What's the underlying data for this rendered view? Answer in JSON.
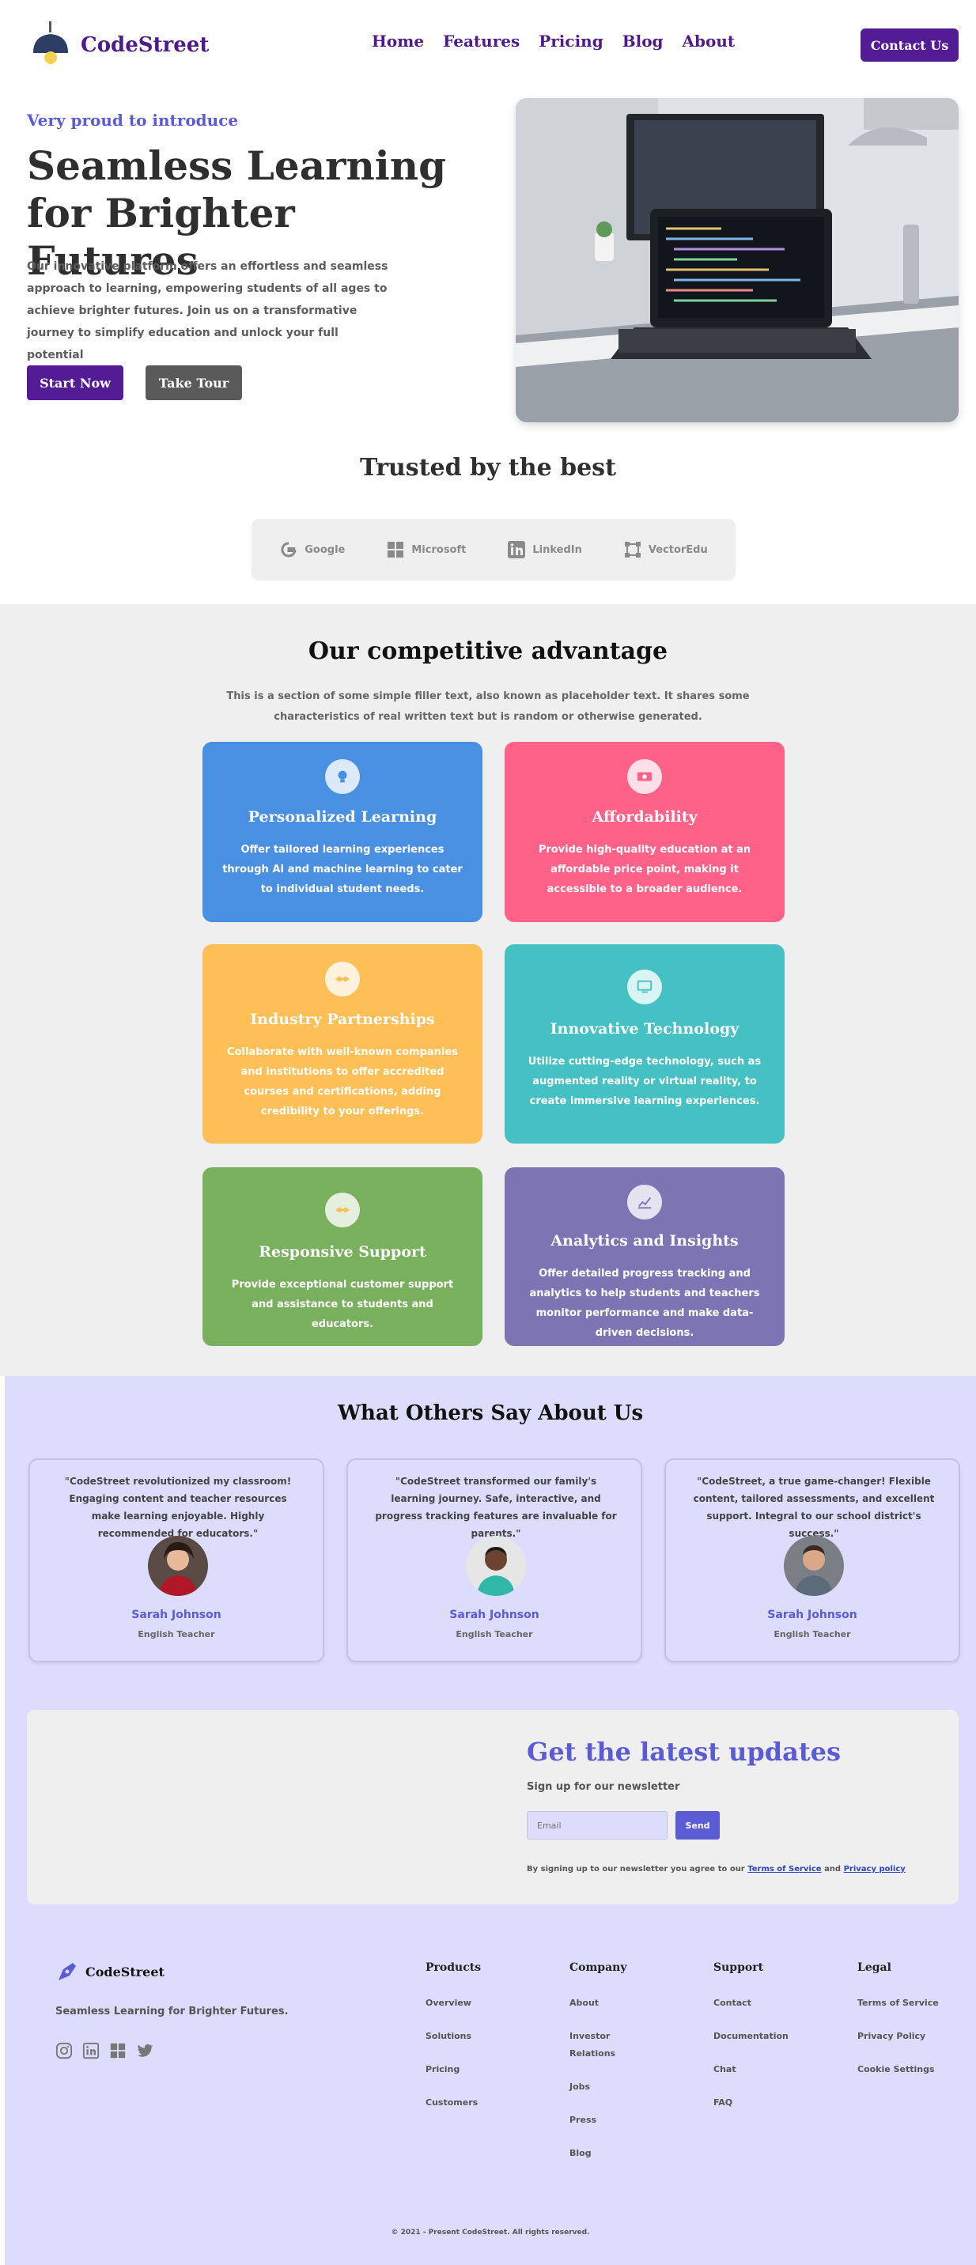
{
  "nav": {
    "brand": "CodeStreet",
    "links": [
      "Home",
      "Features",
      "Pricing",
      "Blog",
      "About"
    ],
    "contact_label": "Contact Us"
  },
  "hero": {
    "kicker": "Very proud to introduce",
    "title": "Seamless Learning for Brighter Futures",
    "description": "Our innovative platform offers an effortless and seamless approach to learning, empowering students of all ages to achieve brighter futures. Join us on a transformative journey to simplify education and unlock your full potential",
    "start_label": "Start Now",
    "tour_label": "Take Tour"
  },
  "trusted": {
    "title": "Trusted by the best",
    "brands": [
      {
        "name": "Google",
        "icon": "google-icon"
      },
      {
        "name": "Microsoft",
        "icon": "microsoft-icon"
      },
      {
        "name": "LinkedIn",
        "icon": "linkedin-icon"
      },
      {
        "name": "VectorEdu",
        "icon": "vector-icon"
      }
    ]
  },
  "advantage": {
    "title": "Our competitive advantage",
    "subtitle": "This is a section of some simple filler text, also known as placeholder text. It shares some characteristics of real written text but is random or otherwise generated.",
    "cards": [
      {
        "title": "Personalized Learning",
        "text": "Offer tailored learning experiences through AI and machine learning to cater to individual student needs.",
        "color": "#4a90e2",
        "icon": "lightbulb-icon"
      },
      {
        "title": "Affordability",
        "text": "Provide high-quality education at an affordable price point, making it accessible to a broader audience.",
        "color": "#ff6288",
        "icon": "money-icon"
      },
      {
        "title": "Industry Partnerships",
        "text": "Collaborate with well-known companies and institutions to offer accredited courses and certifications, adding credibility to your offerings.",
        "color": "#fdbf56",
        "icon": "handshake-icon"
      },
      {
        "title": "Innovative Technology",
        "text": "Utilize cutting-edge technology, such as augmented reality or virtual reality, to create immersive learning experiences.",
        "color": "#45c1c4",
        "icon": "computer-icon"
      },
      {
        "title": "Responsive Support",
        "text": "Provide exceptional customer support and assistance to students and educators.",
        "color": "#79b05e",
        "icon": "support-icon"
      },
      {
        "title": "Analytics and Insights",
        "text": "Offer detailed progress tracking and analytics to help students and teachers monitor performance and make data-driven decisions.",
        "color": "#7c74b3",
        "icon": "chart-icon"
      }
    ]
  },
  "testimonials": {
    "title": "What Others Say About Us",
    "items": [
      {
        "quote": "\"CodeStreet revolutionized my classroom! Engaging content and teacher resources make learning enjoyable. Highly recommended for educators.\"",
        "name": "Sarah Johnson",
        "role": "English Teacher"
      },
      {
        "quote": "\"CodeStreet transformed our family's learning journey. Safe, interactive, and progress tracking features are invaluable for parents.\"",
        "name": "Sarah Johnson",
        "role": "English Teacher"
      },
      {
        "quote": "\"CodeStreet, a true game-changer! Flexible content, tailored assessments, and excellent support. Integral to our school district's success.\"",
        "name": "Sarah Johnson",
        "role": "English Teacher"
      }
    ]
  },
  "newsletter": {
    "title": "Get the latest updates",
    "subtitle": "Sign up for our newsletter",
    "placeholder": "Email",
    "button": "Send",
    "terms_prefix": "By signing up to our newsletter you agree to our",
    "terms_link": "Terms of Service",
    "terms_and": "and",
    "privacy_link": "Privacy policy"
  },
  "footer": {
    "brand": "CodeStreet",
    "tagline": "Seamless Learning for Brighter Futures.",
    "social": [
      "instagram-icon",
      "linkedin-icon",
      "microsoft-icon",
      "twitter-icon"
    ],
    "columns": [
      {
        "title": "Products",
        "items": [
          "Overview",
          "Solutions",
          "Pricing",
          "Customers"
        ]
      },
      {
        "title": "Company",
        "items": [
          "About",
          "Investor Relations",
          "Jobs",
          "Press",
          "Blog"
        ]
      },
      {
        "title": "Support",
        "items": [
          "Contact",
          "Documentation",
          "Chat",
          "FAQ"
        ]
      },
      {
        "title": "Legal",
        "items": [
          "Terms of Service",
          "Privacy Policy",
          "Cookie Settings"
        ]
      }
    ],
    "copyright": "© 2021 - Present CodeStreet. All rights reserved."
  }
}
